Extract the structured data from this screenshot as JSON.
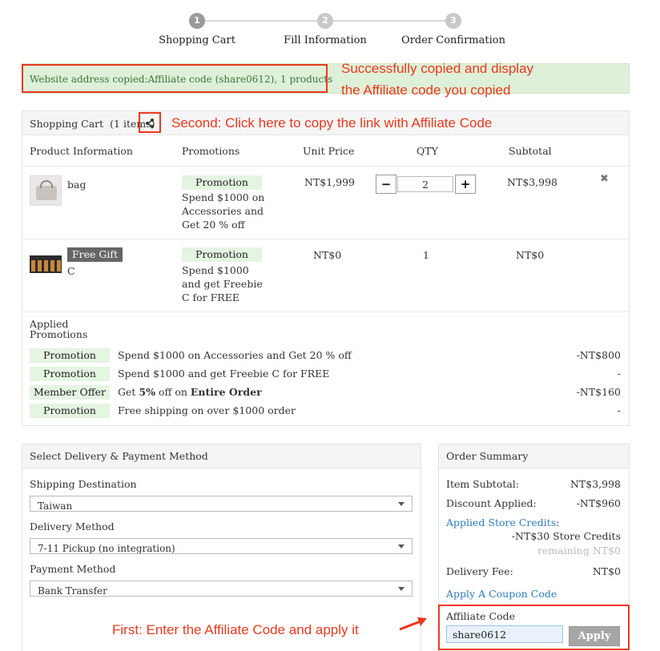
{
  "steps": [
    {
      "num": "1",
      "label": "Shopping Cart"
    },
    {
      "num": "2",
      "label": "Fill Information"
    },
    {
      "num": "3",
      "label": "Order Confirmation"
    }
  ],
  "banner": {
    "text": "Website address copied:Affiliate code (share0612), 1 products"
  },
  "annotations": {
    "success_line1": "Successfully copied and display",
    "success_line2": "the Affiliate code you copied",
    "second": "Second: Click here to copy the link with Affiliate Code",
    "first": "First: Enter the Affiliate Code and apply it"
  },
  "cart": {
    "title": "Shopping Cart",
    "count": "(1 items)",
    "columns": [
      "Product Information",
      "Promotions",
      "Unit Price",
      "QTY",
      "Subtotal"
    ],
    "items": [
      {
        "name": "bag",
        "promo_tag": "Promotion",
        "promo_desc": "Spend $1000 on Accessories and Get 20 % off",
        "unit_price": "NT$1,999",
        "qty": "2",
        "subtotal": "NT$3,998"
      },
      {
        "gift_tag": "Free Gift",
        "name": "C",
        "promo_tag": "Promotion",
        "promo_desc": "Spend $1000 and get Freebie C for FREE",
        "unit_price": "NT$0",
        "qty": "1",
        "subtotal": "NT$0"
      }
    ],
    "applied_title_line1": "Applied",
    "applied_title_line2": "Promotions",
    "applied": [
      {
        "tag": "Promotion",
        "desc": "Spend $1000 on Accessories and Get 20 % off",
        "amount": "-NT$800"
      },
      {
        "tag": "Promotion",
        "desc": "Spend $1000 and get Freebie C for FREE",
        "amount": "-"
      },
      {
        "tag": "Member Offer",
        "desc_pre": "Get ",
        "desc_bold1": "5%",
        "desc_mid": " off on ",
        "desc_bold2": "Entire Order",
        "amount": "-NT$160"
      },
      {
        "tag": "Promotion",
        "desc": "Free shipping on over $1000 order",
        "amount": "-"
      }
    ]
  },
  "delivery": {
    "title": "Select Delivery & Payment Method",
    "shipping_label": "Shipping Destination",
    "shipping_value": "Taiwan",
    "method_label": "Delivery Method",
    "method_value": "7-11 Pickup (no integration)",
    "payment_label": "Payment Method",
    "payment_value": "Bank Transfer"
  },
  "summary": {
    "title": "Order Summary",
    "item_subtotal_label": "Item Subtotal:",
    "item_subtotal": "NT$3,998",
    "discount_label": "Discount Applied:",
    "discount": "-NT$960",
    "store_credits_link": "Applied Store Credits",
    "store_credits_colon": ":",
    "store_credits_value": "-NT$30 Store Credits",
    "remaining": "remaining NT$0",
    "delivery_fee_label": "Delivery Fee:",
    "delivery_fee": "NT$0",
    "coupon_link": "Apply A Coupon Code",
    "affiliate_label": "Affiliate Code",
    "affiliate_value": "share0612",
    "apply_label": "Apply"
  },
  "colors": {
    "accent_red": "#e8391e",
    "promo_green": "#e4f5e1",
    "link_blue": "#2f7bbd",
    "banner_green": "#dff0d8"
  }
}
